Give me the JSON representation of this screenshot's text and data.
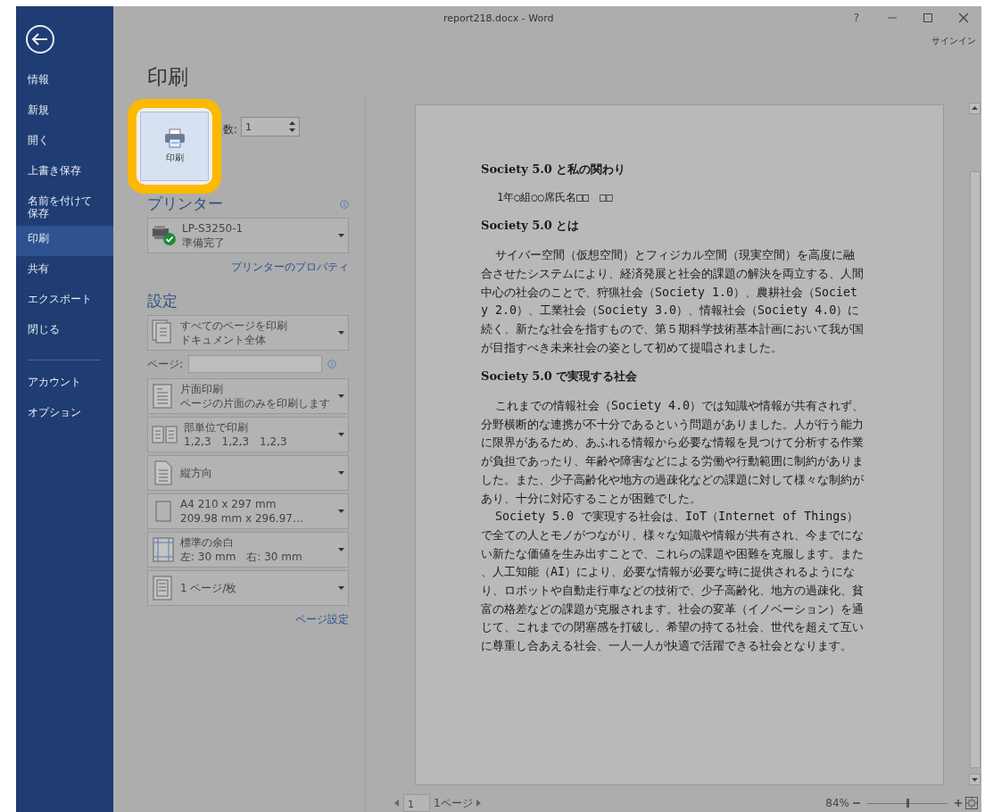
{
  "window": {
    "title": "report218.docx - Word",
    "help": "?",
    "sign_in": "サインイン"
  },
  "sidebar": {
    "items": [
      {
        "label": "情報",
        "selected": false
      },
      {
        "label": "新規",
        "selected": false
      },
      {
        "label": "開く",
        "selected": false
      },
      {
        "label": "上書き保存",
        "selected": false
      },
      {
        "label": "名前を付けて保存",
        "selected": false
      },
      {
        "label": "印刷",
        "selected": true
      },
      {
        "label": "共有",
        "selected": false
      },
      {
        "label": "エクスポート",
        "selected": false
      },
      {
        "label": "閉じる",
        "selected": false
      }
    ],
    "footer_items": [
      {
        "label": "アカウント",
        "selected": false
      },
      {
        "label": "オプション",
        "selected": false
      }
    ]
  },
  "print": {
    "title": "印刷",
    "button": "印刷",
    "highlighted": true,
    "copies": {
      "label": "数:",
      "value": "1"
    }
  },
  "printer": {
    "heading": "プリンター",
    "name": "LP-S3250-1",
    "status": "準備完了",
    "properties_link": "プリンターのプロパティ"
  },
  "settings": {
    "heading": "設定",
    "items": [
      {
        "kind": "pages",
        "title": "すべてのページを印刷",
        "subtitle": "ドキュメント全体"
      },
      {
        "kind": "field",
        "label": "ページ:"
      },
      {
        "kind": "sides",
        "title": "片面印刷",
        "subtitle": "ページの片面のみを印刷します"
      },
      {
        "kind": "collate",
        "title": "部単位で印刷",
        "subtitle": "1,2,3　1,2,3　1,2,3"
      },
      {
        "kind": "orientation",
        "title": "縦方向"
      },
      {
        "kind": "paper",
        "title": "A4 210 x 297 mm",
        "subtitle": "209.98 mm x 296.97…"
      },
      {
        "kind": "margins",
        "title": "標準の余白",
        "subtitle": "左: 30 mm　右: 30 mm"
      },
      {
        "kind": "per_sheet",
        "title": "1 ページ/枚"
      }
    ],
    "page_setup_link": "ページ設定"
  },
  "preview": {
    "blocks": [
      {
        "kind": "title",
        "text": "Society 5.0 と私の関わり"
      },
      {
        "kind": "author",
        "text": "1年○組○○席氏名□□　□□"
      },
      {
        "kind": "heading",
        "text": "Society 5.0 とは"
      },
      {
        "kind": "paragraph",
        "text": "サイバー空間（仮想空間）とフィジカル空間（現実空間）を高度に融合させたシステムにより、経済発展と社会的課題の解決を両立する、人間中心の社会のことで、狩猟社会（Society 1.0）、農耕社会（Society 2.0）、工業社会（Society 3.0）、情報社会（Society 4.0）に続く、新たな社会を指すもので、第５期科学技術基本計画において我が国が目指すべき未来社会の姿として初めて提唱されました。"
      },
      {
        "kind": "heading",
        "text": "Society 5.0 で実現する社会"
      },
      {
        "kind": "paragraph",
        "text": "これまでの情報社会（Society 4.0）では知識や情報が共有されず、分野横断的な連携が不十分であるという問題がありました。人が行う能力に限界があるため、あふれる情報から必要な情報を見つけて分析する作業が負担であったり、年齢や障害などによる労働や行動範囲に制約がありました。また、少子高齢化や地方の過疎化などの課題に対して様々な制約があり、十分に対応することが困難でした。"
      },
      {
        "kind": "paragraph_tight",
        "text": "Society 5.0 で実現する社会は、IoT（Internet of Things）で全ての人とモノがつながり、様々な知識や情報が共有され、今までにない新たな価値を生み出すことで、これらの課題や困難を克服します。また、人工知能（AI）により、必要な情報が必要な時に提供されるようになり、ロボットや自動走行車などの技術で、少子高齢化、地方の過疎化、貧富の格差などの課題が克服されます。社会の変革（イノベーション）を通じて、これまでの閉塞感を打破し、希望の持てる社会、世代を超えて互いに尊重し合あえる社会、一人一人が快適で活躍できる社会となります。"
      }
    ]
  },
  "status_bar": {
    "page_input": "1",
    "page_count": "1ページ",
    "zoom": "84%",
    "zoom_slider": {
      "level": 0.5
    }
  }
}
